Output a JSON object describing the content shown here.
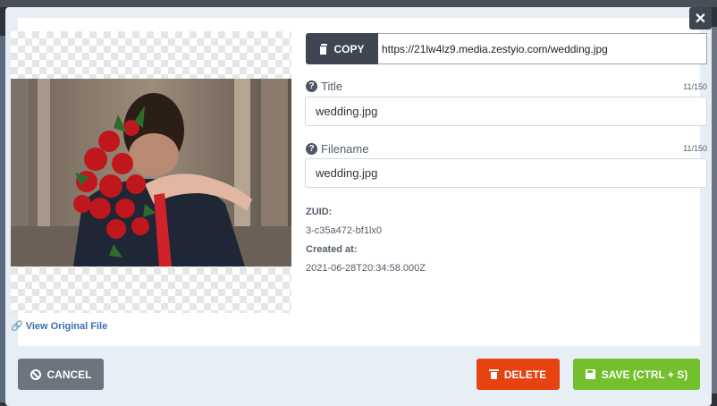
{
  "modal": {
    "close_glyph": "✕",
    "copy_button_label": "COPY",
    "url_value": "https://21lw4lz9.media.zestyio.com/wedding.jpg",
    "view_original_label": "View Original File",
    "title_field": {
      "label": "Title",
      "counter": "11/150",
      "value": "wedding.jpg"
    },
    "filename_field": {
      "label": "Filename",
      "counter": "11/150",
      "value": "wedding.jpg"
    },
    "zuid_label": "ZUID:",
    "zuid_value": "3-c35a472-bf1lx0",
    "created_label": "Created at:",
    "created_value": "2021-06-28T20:34:58.000Z",
    "cancel_label": "CANCEL",
    "delete_label": "DELETE",
    "save_label": "SAVE (CTRL + S)",
    "help_glyph": "?",
    "link_glyph": "🔗"
  },
  "icons": [
    "close-icon",
    "copy-icon",
    "help-icon",
    "link-icon",
    "ban-icon",
    "trash-icon",
    "save-icon"
  ],
  "colors": {
    "dark": "#3e4652",
    "delete": "#e84211",
    "save": "#74bf2d",
    "cancel": "#6c747e",
    "link": "#3b6fb0"
  }
}
